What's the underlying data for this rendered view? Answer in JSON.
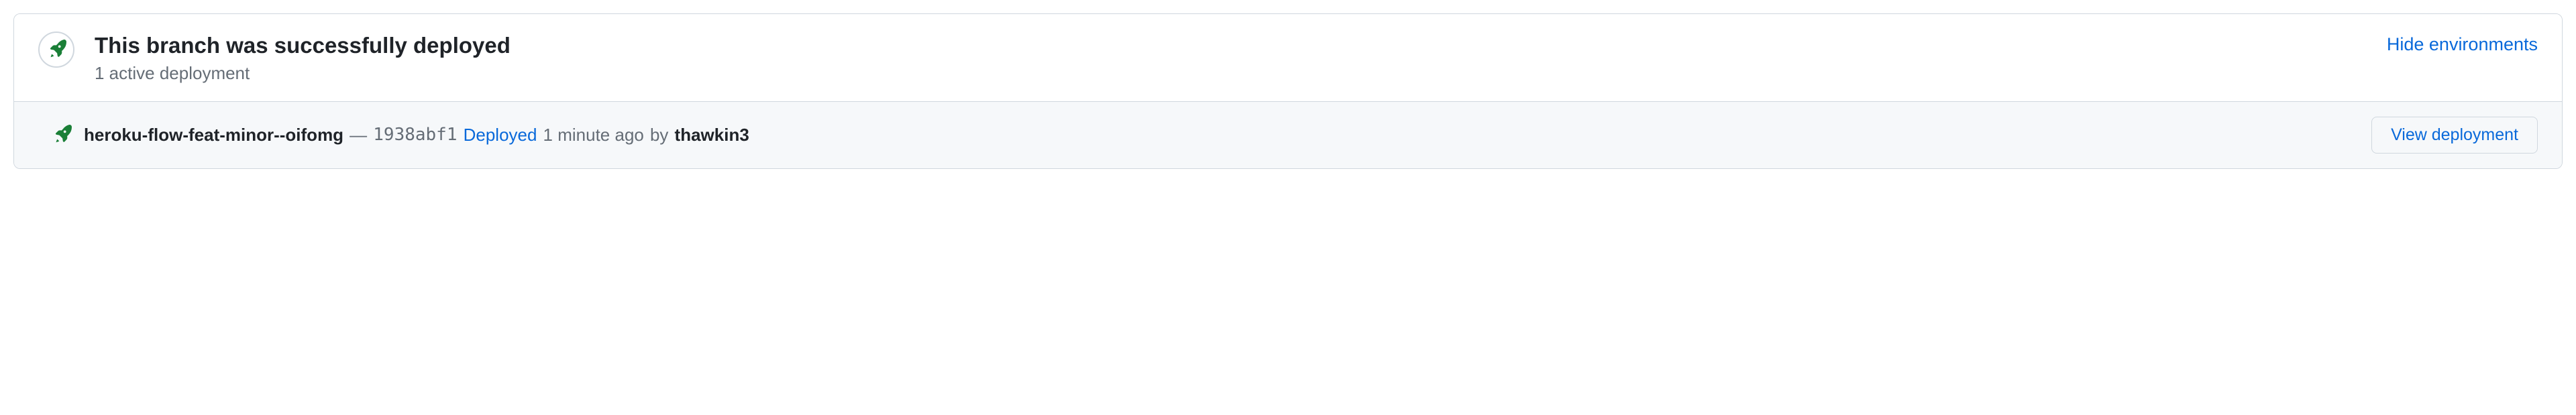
{
  "header": {
    "title": "This branch was successfully deployed",
    "subtitle": "1 active deployment",
    "hide_label": "Hide environments",
    "icon": "rocket-icon",
    "icon_color": "#1a7f37"
  },
  "deployment": {
    "icon": "rocket-icon",
    "icon_color": "#1a7f37",
    "app_name": "heroku-flow-feat-minor--oifomg",
    "separator": "—",
    "commit_sha": "1938abf1",
    "status_label": "Deployed",
    "time_ago": "1 minute ago",
    "by_label": "by",
    "username": "thawkin3",
    "view_button_label": "View deployment"
  }
}
